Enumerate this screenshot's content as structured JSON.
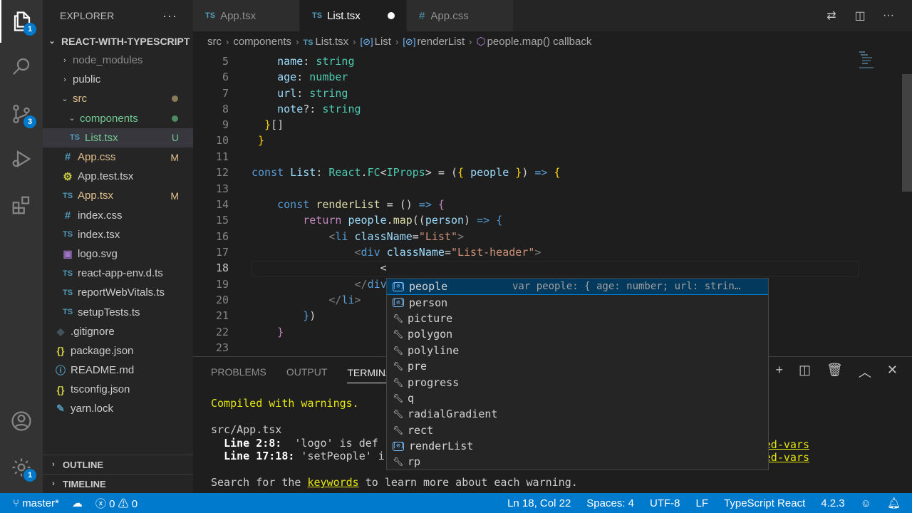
{
  "activity": {
    "explorer_badge": "1",
    "scm_badge": "3",
    "settings_badge": "1"
  },
  "sidebar": {
    "title": "EXPLORER",
    "more": "···",
    "root": "REACT-WITH-TYPESCRIPT",
    "items": [
      {
        "label": "node_modules",
        "icon": ">"
      },
      {
        "label": "public",
        "icon": ">"
      },
      {
        "label": "src",
        "icon": "v"
      },
      {
        "label": "components",
        "icon": "v"
      },
      {
        "label": "List.tsx",
        "icon": "TS",
        "status": "U"
      },
      {
        "label": "App.css",
        "icon": "#",
        "status": "M"
      },
      {
        "label": "App.test.tsx",
        "icon": "gear"
      },
      {
        "label": "App.tsx",
        "icon": "TS",
        "status": "M"
      },
      {
        "label": "index.css",
        "icon": "#"
      },
      {
        "label": "index.tsx",
        "icon": "TS"
      },
      {
        "label": "logo.svg",
        "icon": "img"
      },
      {
        "label": "react-app-env.d.ts",
        "icon": "TS"
      },
      {
        "label": "reportWebVitals.ts",
        "icon": "TS"
      },
      {
        "label": "setupTests.ts",
        "icon": "TS"
      },
      {
        "label": ".gitignore",
        "icon": "git"
      },
      {
        "label": "package.json",
        "icon": "{}"
      },
      {
        "label": "README.md",
        "icon": "i"
      },
      {
        "label": "tsconfig.json",
        "icon": "{}"
      },
      {
        "label": "yarn.lock",
        "icon": "yarn"
      }
    ],
    "outline": "OUTLINE",
    "timeline": "TIMELINE"
  },
  "tabs": [
    {
      "label": "App.tsx",
      "icon": "TS"
    },
    {
      "label": "List.tsx",
      "icon": "TS"
    },
    {
      "label": "App.css",
      "icon": "#"
    }
  ],
  "breadcrumb": [
    "src",
    "components",
    "List.tsx",
    "List",
    "renderList",
    "people.map() callback"
  ],
  "editor": {
    "line_numbers": [
      "5",
      "6",
      "7",
      "8",
      "9",
      "10",
      "11",
      "12",
      "13",
      "14",
      "15",
      "16",
      "17",
      "18",
      "19",
      "20",
      "21",
      "22",
      "23"
    ]
  },
  "panel": {
    "tabs": [
      "PROBLEMS",
      "OUTPUT",
      "TERMINAL"
    ],
    "term": {
      "compiled": "Compiled with warnings.",
      "file": "src/App.tsx",
      "w1_loc": "Line 2:8:",
      "w1_msg": "  'logo' is def",
      "w1_rule": "ed-vars",
      "w2_loc": "Line 17:18:",
      "w2_msg": " 'setPeople' i",
      "w2_rule": "ed-vars",
      "search_a": "Search for the ",
      "keywords": "keywords",
      "search_b": " to learn more about each warning."
    }
  },
  "suggest": {
    "items": [
      {
        "label": "people",
        "kind": "var",
        "detail": "var people: { age: number; url: strin…"
      },
      {
        "label": "person",
        "kind": "var"
      },
      {
        "label": "picture",
        "kind": "kw"
      },
      {
        "label": "polygon",
        "kind": "kw"
      },
      {
        "label": "polyline",
        "kind": "kw"
      },
      {
        "label": "pre",
        "kind": "kw"
      },
      {
        "label": "progress",
        "kind": "kw"
      },
      {
        "label": "q",
        "kind": "kw"
      },
      {
        "label": "radialGradient",
        "kind": "kw"
      },
      {
        "label": "rect",
        "kind": "kw"
      },
      {
        "label": "renderList",
        "kind": "var"
      },
      {
        "label": "rp",
        "kind": "kw"
      }
    ]
  },
  "status": {
    "branch": "master*",
    "errors": "0",
    "warnings": "0",
    "position": "Ln 18, Col 22",
    "spaces": "Spaces: 4",
    "encoding": "UTF-8",
    "eol": "LF",
    "language": "TypeScript React",
    "version": "4.2.3"
  },
  "colors": {
    "accent": "#007acc",
    "modified": "#e2c08d",
    "untracked": "#73c991"
  }
}
